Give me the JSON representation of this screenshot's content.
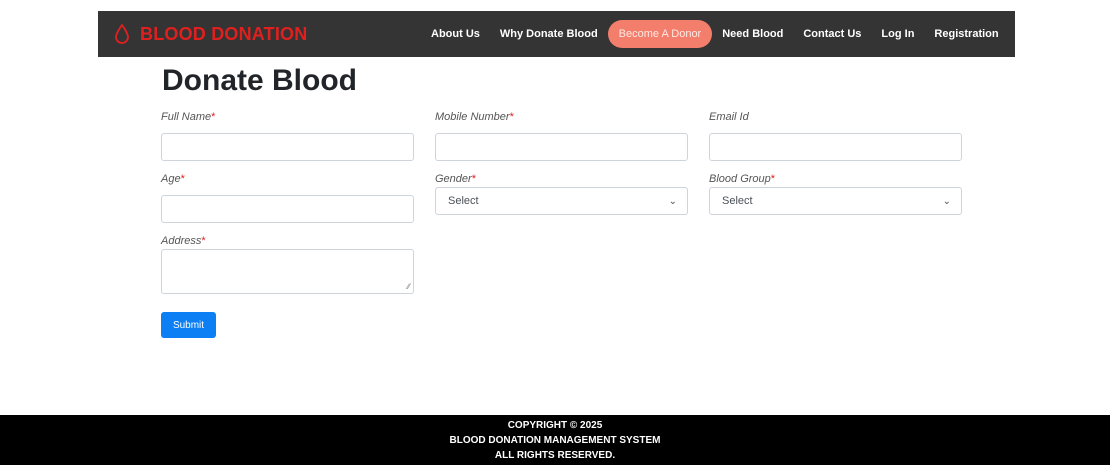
{
  "brand": {
    "name": "BLOOD DONATION",
    "color": "#e0201f"
  },
  "nav": {
    "items": [
      {
        "label": "About Us"
      },
      {
        "label": "Why Donate Blood"
      },
      {
        "label": "Become A Donor",
        "active": true
      },
      {
        "label": "Need Blood"
      },
      {
        "label": "Contact Us"
      },
      {
        "label": "Log In"
      },
      {
        "label": "Registration"
      }
    ],
    "active_color": "#f37e6b"
  },
  "page": {
    "title": "Donate Blood"
  },
  "form": {
    "full_name_label": "Full Name",
    "mobile_label": "Mobile Number",
    "email_label": "Email Id",
    "age_label": "Age",
    "gender_label": "Gender",
    "gender_value": "Select",
    "blood_group_label": "Blood Group",
    "blood_group_value": "Select",
    "address_label": "Address",
    "required_marker": "*",
    "submit_label": "Submit"
  },
  "footer": {
    "line1": "COPYRIGHT © 2025",
    "line2": "BLOOD DONATION MANAGEMENT SYSTEM",
    "line3": "ALL RIGHTS RESERVED."
  }
}
